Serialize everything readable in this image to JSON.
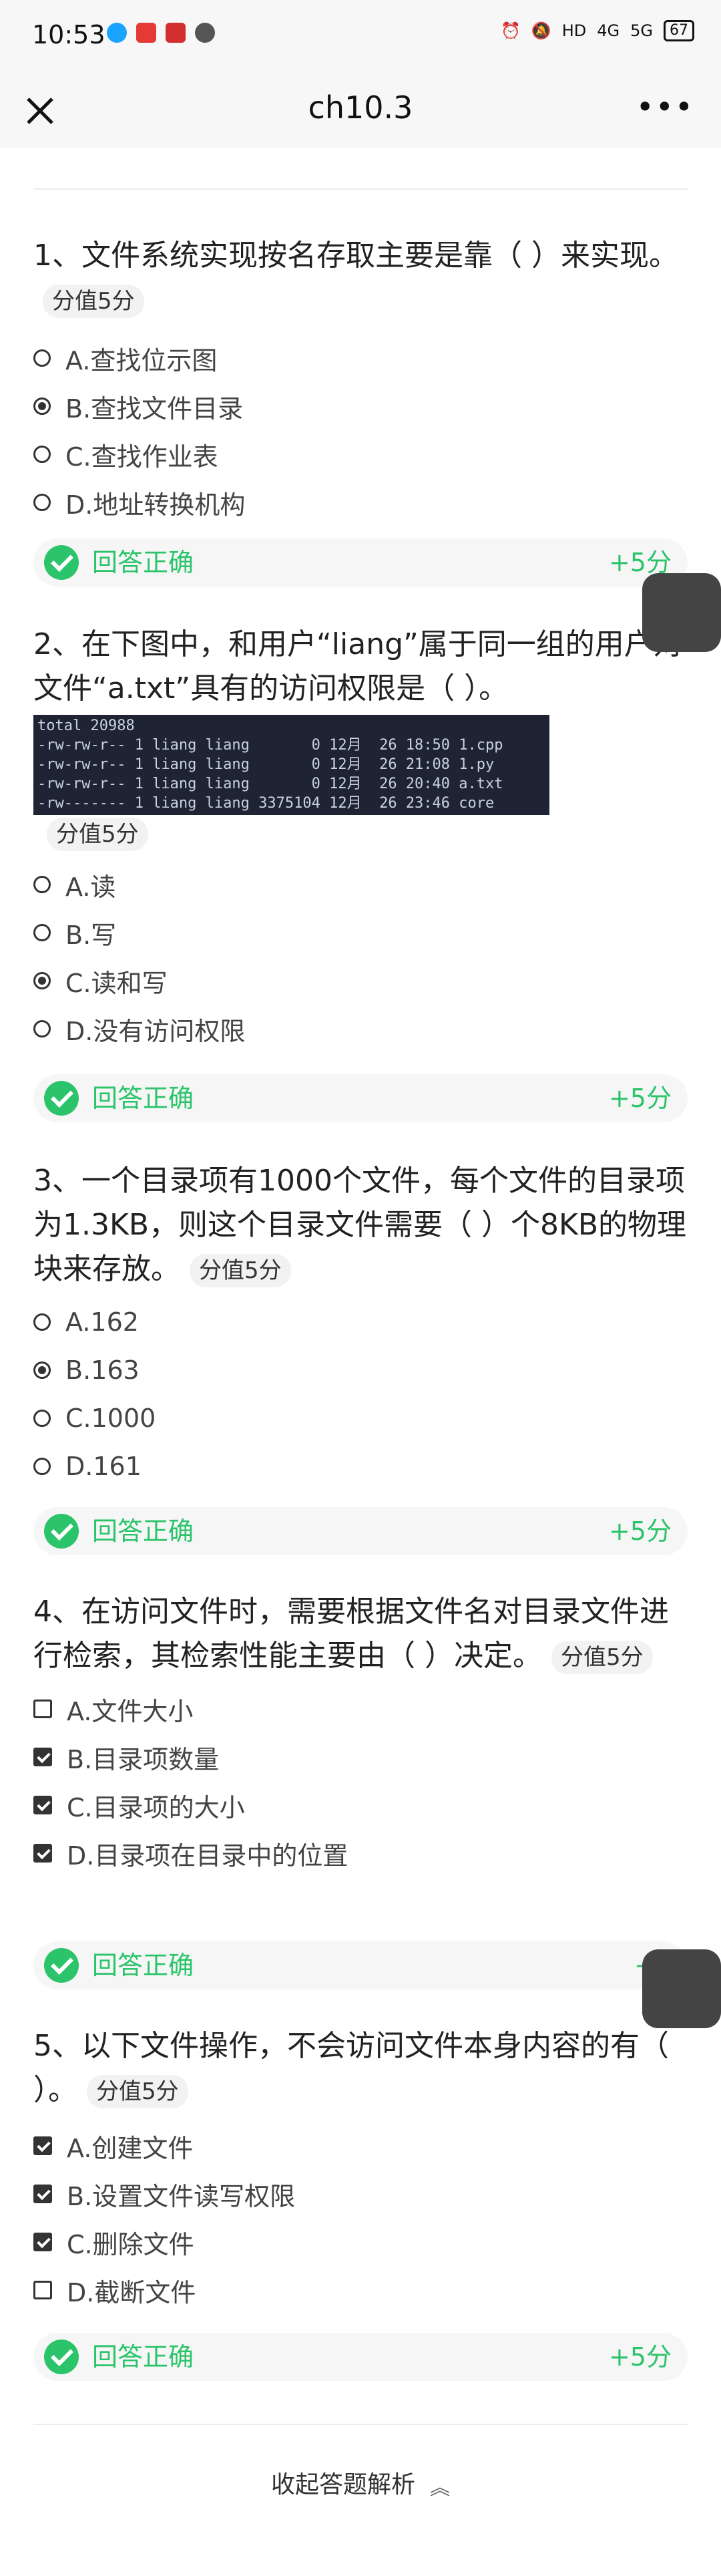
{
  "status_bar": {
    "time": "10:53",
    "icons": [
      "qq-icon",
      "app-red-icon",
      "app-red2-icon",
      "chat-icon"
    ],
    "right_text": [
      "HD",
      "4G",
      "5G"
    ],
    "battery": "67"
  },
  "nav": {
    "title": "ch10.3"
  },
  "questions": [
    {
      "title": "1、文件系统实现按名存取主要是靠（ ）来实现。",
      "score_tag": "分值5分",
      "options": [
        "A.查找位示图",
        "B.查找文件目录",
        "C.查找作业表",
        "D.地址转换机构"
      ],
      "result": "回答正确",
      "gain": "+5分"
    },
    {
      "title": "2、在下图中，和用户“liang”属于同一组的用户对文件“a.txt”具有的访问权限是（ ）。",
      "terminal": "total 20988\n-rw-rw-r-- 1 liang liang       0 12月  26 18:50 1.cpp\n-rw-rw-r-- 1 liang liang       0 12月  26 21:08 1.py\n-rw-rw-r-- 1 liang liang       0 12月  26 20:40 a.txt\n-rw------- 1 liang liang 3375104 12月  26 23:46 core",
      "score_tag": "分值5分",
      "options": [
        "A.读",
        "B.写",
        "C.读和写",
        "D.没有访问权限"
      ],
      "result": "回答正确",
      "gain": "+5分"
    },
    {
      "title": "3、一个目录项有1000个文件，每个文件的目录项为1.3KB，则这个目录文件需要（ ）个8KB的物理块来存放。",
      "score_tag": "分值5分",
      "options": [
        "A.162",
        "B.163",
        "C.1000",
        "D.161"
      ],
      "result": "回答正确",
      "gain": "+5分"
    },
    {
      "title": "4、在访问文件时，需要根据文件名对目录文件进行检索，其检索性能主要由（ ）决定。",
      "score_tag": "分值5分",
      "options": [
        "A.文件大小",
        "B.目录项数量",
        "C.目录项的大小",
        "D.目录项在目录中的位置"
      ],
      "result": "回答正确",
      "gain": "+5"
    },
    {
      "title": "5、以下文件操作，不会访问文件本身内容的有（ ）。",
      "score_tag": "分值5分",
      "options": [
        "A.创建文件",
        "B.设置文件读写权限",
        "C.删除文件",
        "D.截断文件"
      ],
      "result": "回答正确",
      "gain": "+5分"
    }
  ],
  "footer": {
    "collapse_label": "收起答题解析"
  }
}
